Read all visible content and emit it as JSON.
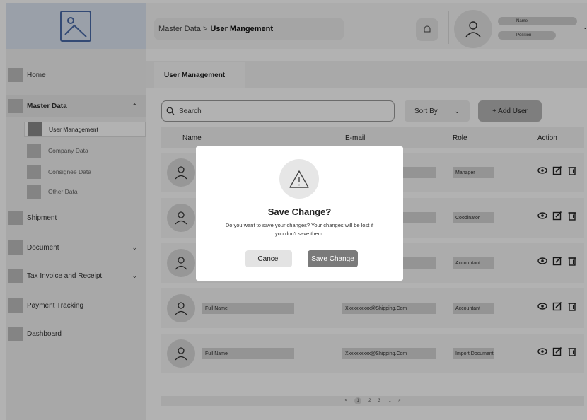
{
  "header": {
    "breadcrumb_root": "Master Data >",
    "breadcrumb_current": "User Mangement",
    "user_name": "Name",
    "user_position": "Position"
  },
  "sidebar": {
    "items": [
      {
        "label": "Home"
      },
      {
        "label": "Master Data"
      },
      {
        "label": "Shipment"
      },
      {
        "label": "Document"
      },
      {
        "label": "Tax Invoice and Receipt"
      },
      {
        "label": "Payment Tracking"
      },
      {
        "label": "Dashboard"
      }
    ],
    "sub_items": [
      {
        "label": "User Management"
      },
      {
        "label": "Company Data"
      },
      {
        "label": "Consignee Data"
      },
      {
        "label": "Other Data"
      }
    ]
  },
  "main": {
    "tab_label": "User Management",
    "search_placeholder": "Search",
    "sort_label": "Sort By",
    "add_user_label": "+ Add User",
    "columns": [
      "Name",
      "E-mail",
      "Role",
      "Action"
    ],
    "rows": [
      {
        "name": "",
        "email": "m",
        "role": "Manager"
      },
      {
        "name": "",
        "email": "m",
        "role": "Coodinator"
      },
      {
        "name": "",
        "email": "m",
        "role": "Accountant"
      },
      {
        "name": "Full Name",
        "email": "Xxxxxxxxxx@Shipping.Com",
        "role": "Accountant"
      },
      {
        "name": "Full Name",
        "email": "Xxxxxxxxxx@Shipping.Com",
        "role": "Import Document"
      }
    ],
    "pagination": {
      "prev": "<",
      "pages": [
        "1",
        "2",
        "3",
        "..."
      ],
      "next": ">"
    }
  },
  "modal": {
    "title": "Save Change?",
    "message": "Do you want to save your changes? Your changes will be lost if you don't save them.",
    "cancel_label": "Cancel",
    "save_label": "Save Change"
  }
}
